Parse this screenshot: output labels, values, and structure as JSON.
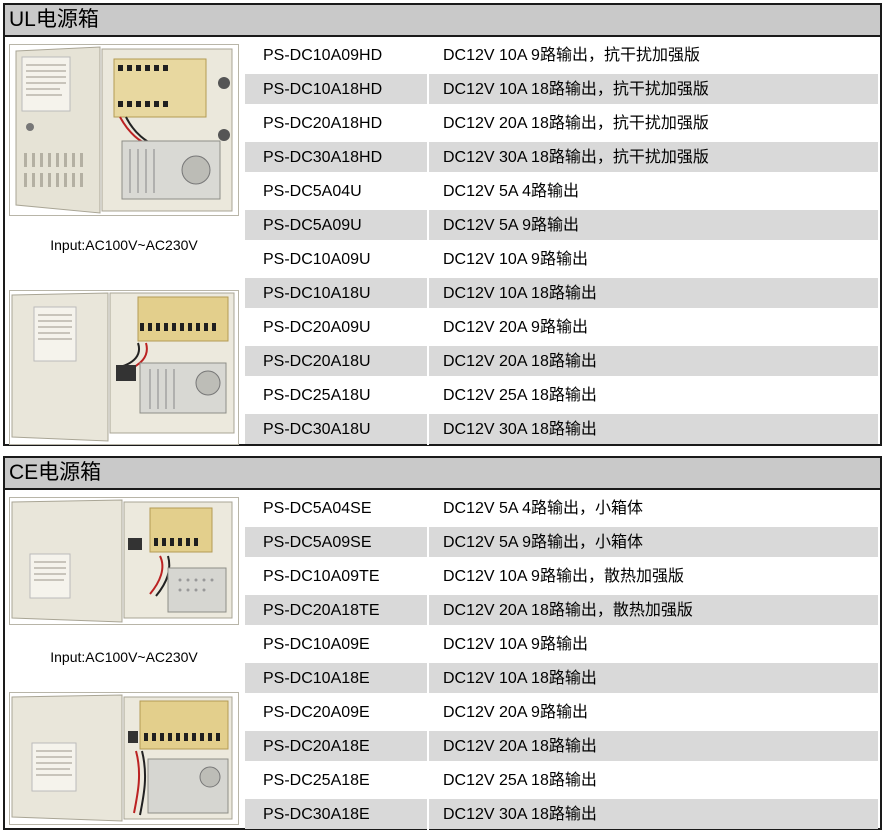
{
  "ul": {
    "title": "UL电源箱",
    "input_label": "Input:AC100V~AC230V",
    "rows": [
      {
        "model": "PS-DC10A09HD",
        "desc": "DC12V 10A  9路输出，抗干扰加强版"
      },
      {
        "model": "PS-DC10A18HD",
        "desc": "DC12V 10A 18路输出，抗干扰加强版"
      },
      {
        "model": "PS-DC20A18HD",
        "desc": "DC12V 20A 18路输出，抗干扰加强版"
      },
      {
        "model": "PS-DC30A18HD",
        "desc": "DC12V 30A 18路输出，抗干扰加强版"
      },
      {
        "model": "PS-DC5A04U",
        "desc": "DC12V 5A    4路输出"
      },
      {
        "model": "PS-DC5A09U",
        "desc": "DC12V 5A    9路输出"
      },
      {
        "model": "PS-DC10A09U",
        "desc": "DC12V 10A  9路输出"
      },
      {
        "model": "PS-DC10A18U",
        "desc": "DC12V 10A  18路输出"
      },
      {
        "model": "PS-DC20A09U",
        "desc": "DC12V 20A  9路输出"
      },
      {
        "model": "PS-DC20A18U",
        "desc": "DC12V 20A  18路输出"
      },
      {
        "model": "PS-DC25A18U",
        "desc": "DC12V 25A  18路输出"
      },
      {
        "model": "PS-DC30A18U",
        "desc": "DC12V 30A  18路输出"
      }
    ]
  },
  "ce": {
    "title": "CE电源箱",
    "input_label": "Input:AC100V~AC230V",
    "rows": [
      {
        "model": "PS-DC5A04SE",
        "desc": "DC12V 5A    4路输出，小箱体"
      },
      {
        "model": "PS-DC5A09SE",
        "desc": "DC12V 5A    9路输出，小箱体"
      },
      {
        "model": "PS-DC10A09TE",
        "desc": "DC12V 10A  9路输出，散热加强版"
      },
      {
        "model": "PS-DC20A18TE",
        "desc": "DC12V 20A 18路输出，散热加强版"
      },
      {
        "model": "PS-DC10A09E",
        "desc": "DC12V 10A  9路输出"
      },
      {
        "model": "PS-DC10A18E",
        "desc": "DC12V 10A 18路输出"
      },
      {
        "model": "PS-DC20A09E",
        "desc": "DC12V 20A  9路输出"
      },
      {
        "model": "PS-DC20A18E",
        "desc": "DC12V 20A 18路输出"
      },
      {
        "model": "PS-DC25A18E",
        "desc": "DC12V 25A 18路输出"
      },
      {
        "model": "PS-DC30A18E",
        "desc": "DC12V 30A 18路输出"
      }
    ]
  }
}
